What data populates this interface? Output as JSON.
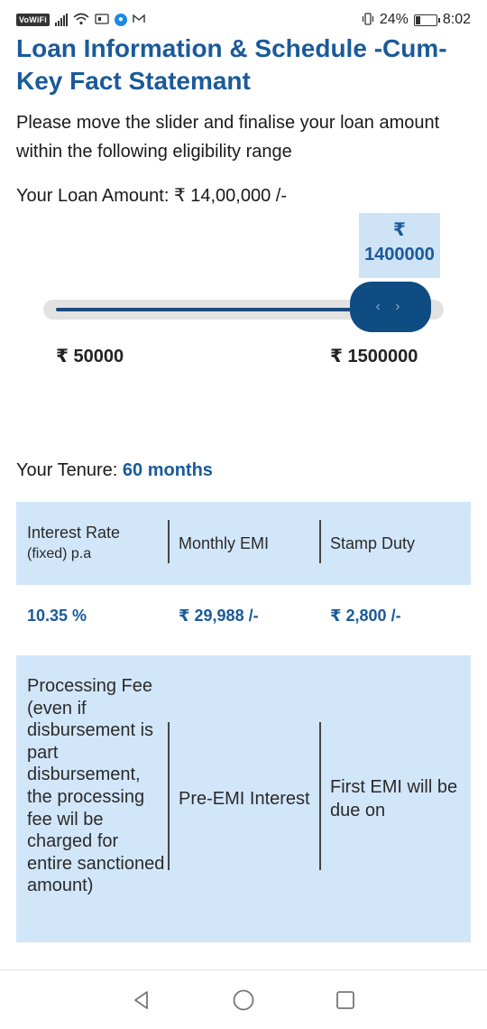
{
  "status_bar": {
    "vowifi": "VoWiFi",
    "battery": "24%",
    "time": "8:02",
    "battery_level": 0.24
  },
  "page_title": "Loan Information & Schedule -Cum-Key Fact Statemant",
  "intro": "Please move the slider and finalise your loan amount within the following eligibility range",
  "loan_amount": {
    "label": "Your Loan Amount:",
    "value": "₹ 14,00,000 /-"
  },
  "slider": {
    "rupee_symbol": "₹",
    "current_value": "1400000",
    "min_label": "₹ 50000",
    "max_label": "₹ 1500000",
    "min": 50000,
    "max": 1500000,
    "value": 1400000,
    "thumb_glyph": "‹ ›"
  },
  "tenure": {
    "label": "Your Tenure:",
    "value": "60 months"
  },
  "summary_table": {
    "headers": {
      "interest_rate": "Interest Rate",
      "interest_rate_sub": "(fixed) p.a",
      "monthly_emi": "Monthly EMI",
      "stamp_duty": "Stamp Duty"
    },
    "values": {
      "interest_rate": "10.35 %",
      "monthly_emi": "₹ 29,988 /-",
      "stamp_duty": "₹ 2,800 /-"
    }
  },
  "fee_table": {
    "headers": {
      "processing_fee": "Processing Fee (even if disbursement is part disbursement, the processing fee wil be charged for entire sanctioned amount)",
      "pre_emi": "Pre-EMI Interest",
      "first_emi": "First EMI will be due on"
    }
  },
  "colors": {
    "accent": "#1a5a9a",
    "panel": "#d2e6fa",
    "thumb": "#0f4c82"
  }
}
